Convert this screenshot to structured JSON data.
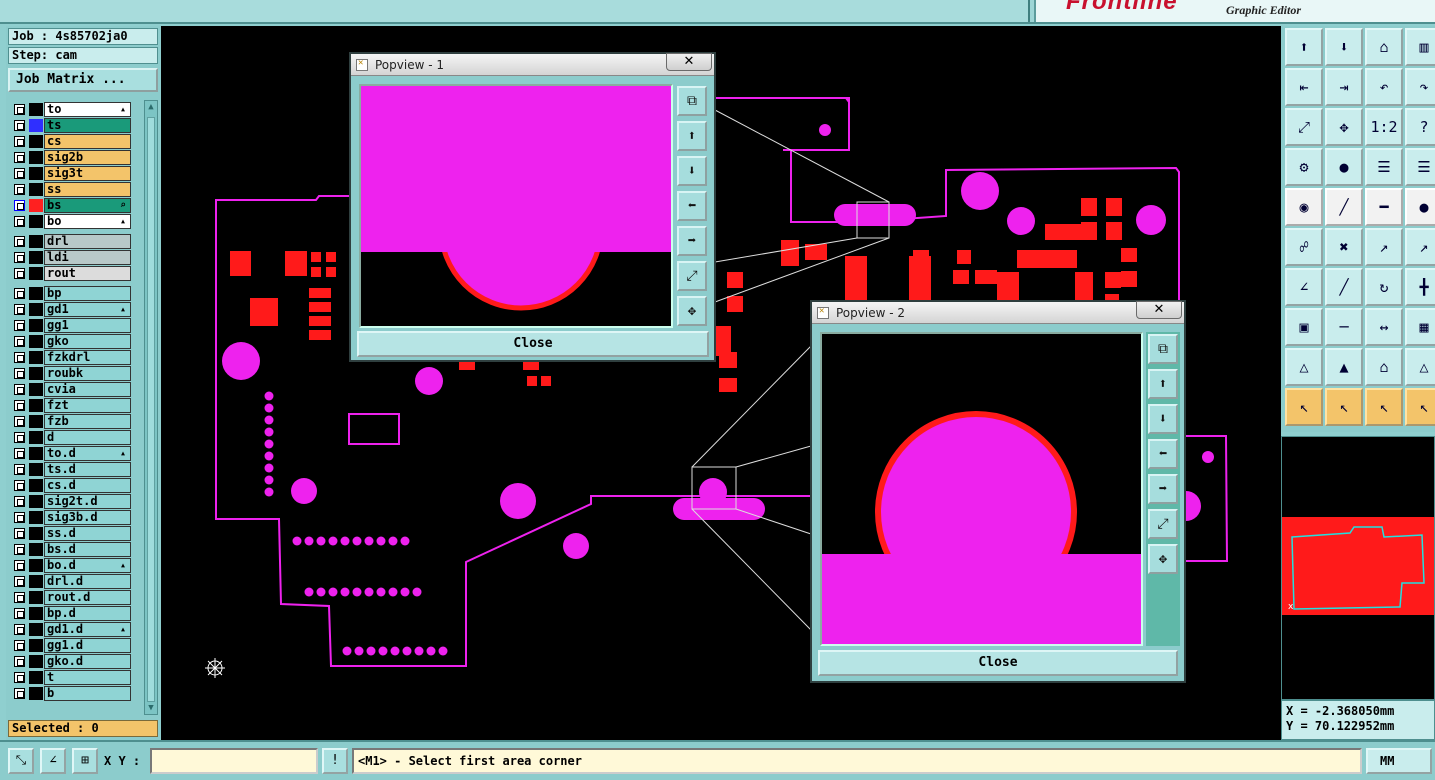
{
  "brand": {
    "logo": "Frontline",
    "subtitle": "Graphic Editor"
  },
  "job": {
    "job_line": "Job : 4s85702ja0",
    "step_line": "Step: cam",
    "matrix_label": "Job Matrix ..."
  },
  "layers": [
    {
      "name": "to",
      "bg": "#ffffff",
      "swatch": "#000000",
      "flag": "▴"
    },
    {
      "name": "ts",
      "bg": "#1a9a7a",
      "swatch": "#2f2fff",
      "flag": ""
    },
    {
      "name": "cs",
      "bg": "#f3c46a",
      "swatch": "#000000",
      "flag": ""
    },
    {
      "name": "sig2b",
      "bg": "#f3c46a",
      "swatch": "#000000",
      "flag": ""
    },
    {
      "name": "sig3t",
      "bg": "#f3c46a",
      "swatch": "#000000",
      "flag": ""
    },
    {
      "name": "ss",
      "bg": "#f3c46a",
      "swatch": "#000000",
      "flag": ""
    },
    {
      "name": "bs",
      "bg": "#1a9a7a",
      "swatch": "#ff2020",
      "flag": "⌕",
      "blue_cb": true
    },
    {
      "name": "bo",
      "bg": "#ffffff",
      "swatch": "#000000",
      "flag": "▴"
    },
    {
      "name": "drl",
      "bg": "#b8c8c8",
      "swatch": "#000000",
      "flag": "",
      "gap": true
    },
    {
      "name": "ldi",
      "bg": "#b8c8c8",
      "swatch": "#000000",
      "flag": ""
    },
    {
      "name": "rout",
      "bg": "#dcdcdc",
      "swatch": "#000000",
      "flag": ""
    },
    {
      "name": "bp",
      "bg": "#8fd4d4",
      "swatch": "#000000",
      "flag": "",
      "gap": true
    },
    {
      "name": "gd1",
      "bg": "#8fd4d4",
      "swatch": "#000000",
      "flag": "▴"
    },
    {
      "name": "gg1",
      "bg": "#8fd4d4",
      "swatch": "#000000",
      "flag": ""
    },
    {
      "name": "gko",
      "bg": "#8fd4d4",
      "swatch": "#000000",
      "flag": ""
    },
    {
      "name": "fzkdrl",
      "bg": "#8fd4d4",
      "swatch": "#000000",
      "flag": ""
    },
    {
      "name": "roubk",
      "bg": "#8fd4d4",
      "swatch": "#000000",
      "flag": ""
    },
    {
      "name": "cvia",
      "bg": "#8fd4d4",
      "swatch": "#000000",
      "flag": ""
    },
    {
      "name": "fzt",
      "bg": "#8fd4d4",
      "swatch": "#000000",
      "flag": ""
    },
    {
      "name": "fzb",
      "bg": "#8fd4d4",
      "swatch": "#000000",
      "flag": ""
    },
    {
      "name": "d",
      "bg": "#8fd4d4",
      "swatch": "#000000",
      "flag": ""
    },
    {
      "name": "to.d",
      "bg": "#8fd4d4",
      "swatch": "#000000",
      "flag": "▴"
    },
    {
      "name": "ts.d",
      "bg": "#8fd4d4",
      "swatch": "#000000",
      "flag": ""
    },
    {
      "name": "cs.d",
      "bg": "#8fd4d4",
      "swatch": "#000000",
      "flag": ""
    },
    {
      "name": "sig2t.d",
      "bg": "#8fd4d4",
      "swatch": "#000000",
      "flag": ""
    },
    {
      "name": "sig3b.d",
      "bg": "#8fd4d4",
      "swatch": "#000000",
      "flag": ""
    },
    {
      "name": "ss.d",
      "bg": "#8fd4d4",
      "swatch": "#000000",
      "flag": ""
    },
    {
      "name": "bs.d",
      "bg": "#8fd4d4",
      "swatch": "#000000",
      "flag": ""
    },
    {
      "name": "bo.d",
      "bg": "#8fd4d4",
      "swatch": "#000000",
      "flag": "▴"
    },
    {
      "name": "drl.d",
      "bg": "#8fd4d4",
      "swatch": "#000000",
      "flag": ""
    },
    {
      "name": "rout.d",
      "bg": "#8fd4d4",
      "swatch": "#000000",
      "flag": ""
    },
    {
      "name": "bp.d",
      "bg": "#8fd4d4",
      "swatch": "#000000",
      "flag": ""
    },
    {
      "name": "gd1.d",
      "bg": "#8fd4d4",
      "swatch": "#000000",
      "flag": "▴"
    },
    {
      "name": "gg1.d",
      "bg": "#8fd4d4",
      "swatch": "#000000",
      "flag": ""
    },
    {
      "name": "gko.d",
      "bg": "#8fd4d4",
      "swatch": "#000000",
      "flag": ""
    },
    {
      "name": "t",
      "bg": "#8fd4d4",
      "swatch": "#000000",
      "flag": ""
    },
    {
      "name": "b",
      "bg": "#8fd4d4",
      "swatch": "#000000",
      "flag": ""
    }
  ],
  "selected_label": "Selected : 0",
  "popview1": {
    "title": "Popview - 1",
    "close_x": "✕",
    "close_label": "Close"
  },
  "popview2": {
    "title": "Popview - 2",
    "close_x": "✕",
    "close_label": "Close"
  },
  "popview_tools": [
    "zoom-window-icon",
    "pan-up-icon",
    "pan-down-icon",
    "pan-left-icon",
    "pan-right-icon",
    "zoom-fit-icon",
    "zoom-home-icon"
  ],
  "coords": {
    "x_line": "X = -2.368050mm",
    "y_line": "Y = 70.122952mm"
  },
  "bottom": {
    "xy_label": "X Y :",
    "xy_value": "",
    "message": "<M1> - Select first area corner",
    "unit": "MM"
  },
  "colors": {
    "pad": "#ee22ee",
    "copper": "#ff1a1a",
    "panel": "#8ccccc",
    "accent": "#f3c46a"
  }
}
